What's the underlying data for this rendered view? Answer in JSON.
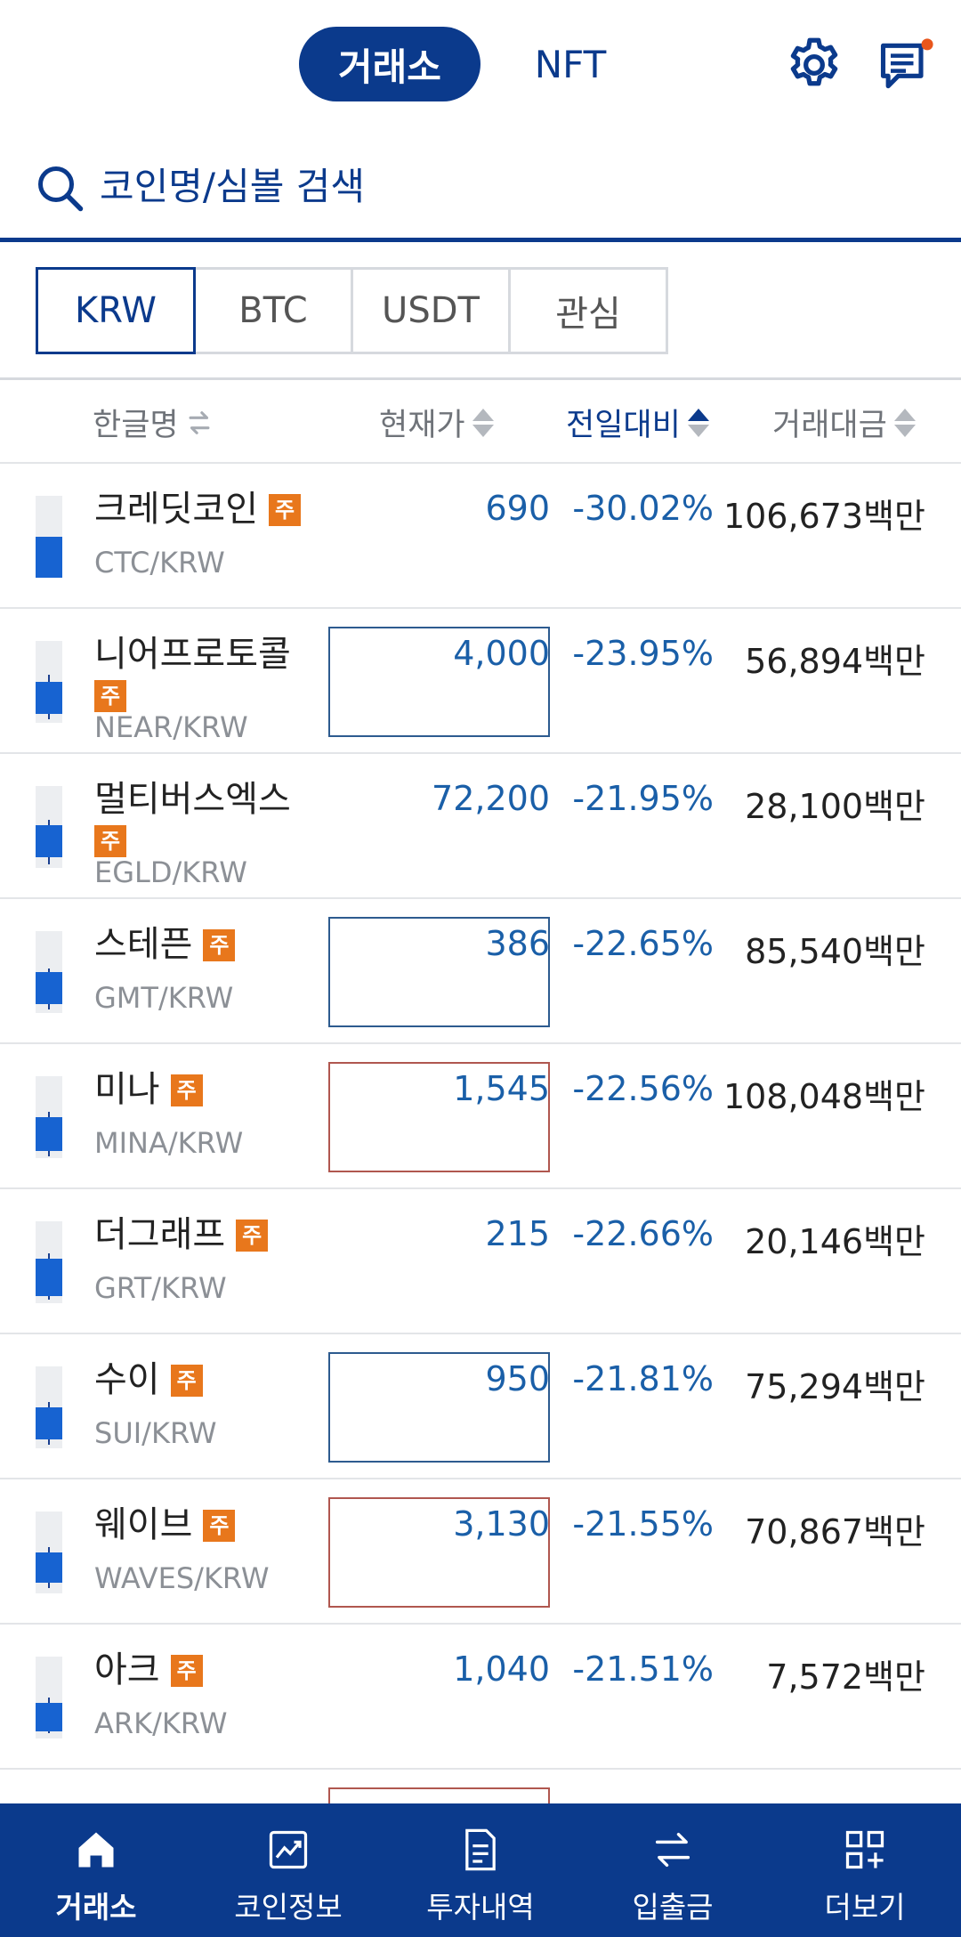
{
  "header": {
    "tab_exchange": "거래소",
    "tab_nft": "NFT",
    "notification_dot_color": "#e8561c"
  },
  "search": {
    "placeholder": "코인명/심볼 검색"
  },
  "market_tabs": [
    "KRW",
    "BTC",
    "USDT",
    "관심"
  ],
  "columns": {
    "name": "한글명",
    "price": "현재가",
    "change": "전일대비",
    "volume": "거래대금"
  },
  "colors": {
    "brand": "#0b3a8c",
    "fall_blue": "#1a5fa8",
    "badge_orange": "#e8771c"
  },
  "coins": [
    {
      "name": "크레딧코인",
      "badge": "주",
      "symbol": "CTC/KRW",
      "price": "690",
      "change": "-30.02%",
      "volume": "106,673백만"
    },
    {
      "name": "니어프로토콜",
      "badge": "주",
      "symbol": "NEAR/KRW",
      "price": "4,000",
      "change": "-23.95%",
      "volume": "56,894백만"
    },
    {
      "name": "멀티버스엑스",
      "badge": "주",
      "symbol": "EGLD/KRW",
      "price": "72,200",
      "change": "-21.95%",
      "volume": "28,100백만"
    },
    {
      "name": "스테픈",
      "badge": "주",
      "symbol": "GMT/KRW",
      "price": "386",
      "change": "-22.65%",
      "volume": "85,540백만"
    },
    {
      "name": "미나",
      "badge": "주",
      "symbol": "MINA/KRW",
      "price": "1,545",
      "change": "-22.56%",
      "volume": "108,048백만"
    },
    {
      "name": "더그래프",
      "badge": "주",
      "symbol": "GRT/KRW",
      "price": "215",
      "change": "-22.66%",
      "volume": "20,146백만"
    },
    {
      "name": "수이",
      "badge": "주",
      "symbol": "SUI/KRW",
      "price": "950",
      "change": "-21.81%",
      "volume": "75,294백만"
    },
    {
      "name": "웨이브",
      "badge": "주",
      "symbol": "WAVES/KRW",
      "price": "3,130",
      "change": "-21.55%",
      "volume": "70,867백만"
    },
    {
      "name": "아크",
      "badge": "주",
      "symbol": "ARK/KRW",
      "price": "1,040",
      "change": "-21.51%",
      "volume": "7,572백만"
    }
  ],
  "bottom_nav": [
    {
      "label": "거래소",
      "icon": "home-icon"
    },
    {
      "label": "코인정보",
      "icon": "chart-icon"
    },
    {
      "label": "투자내역",
      "icon": "document-icon"
    },
    {
      "label": "입출금",
      "icon": "transfer-icon"
    },
    {
      "label": "더보기",
      "icon": "grid-plus-icon"
    }
  ]
}
